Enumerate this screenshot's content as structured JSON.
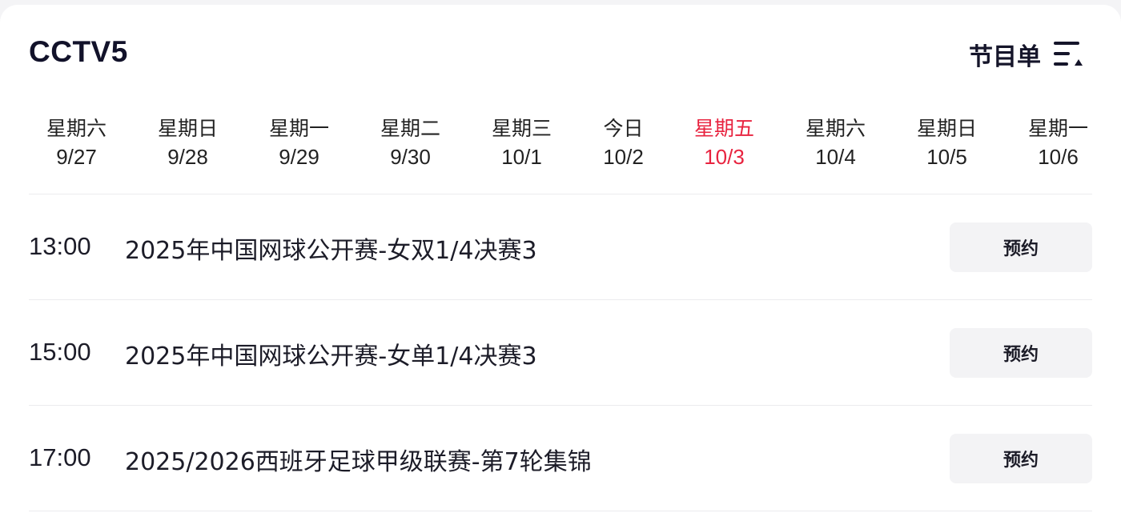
{
  "header": {
    "channel": "CCTV5",
    "guide_label": "节目单",
    "guide_icon": "list-sort-icon"
  },
  "days": [
    {
      "name": "星期六",
      "date": "9/27",
      "active": false
    },
    {
      "name": "星期日",
      "date": "9/28",
      "active": false
    },
    {
      "name": "星期一",
      "date": "9/29",
      "active": false
    },
    {
      "name": "星期二",
      "date": "9/30",
      "active": false
    },
    {
      "name": "星期三",
      "date": "10/1",
      "active": false
    },
    {
      "name": "今日",
      "date": "10/2",
      "active": false
    },
    {
      "name": "星期五",
      "date": "10/3",
      "active": true
    },
    {
      "name": "星期六",
      "date": "10/4",
      "active": false
    },
    {
      "name": "星期日",
      "date": "10/5",
      "active": false
    },
    {
      "name": "星期一",
      "date": "10/6",
      "active": false
    }
  ],
  "programs": [
    {
      "time": "13:00",
      "title": "2025年中国网球公开赛-女双1/4决赛3",
      "action": "预约"
    },
    {
      "time": "15:00",
      "title": "2025年中国网球公开赛-女单1/4决赛3",
      "action": "预约"
    },
    {
      "time": "17:00",
      "title": "2025/2026西班牙足球甲级联赛-第7轮集锦",
      "action": "预约"
    }
  ],
  "colors": {
    "accent": "#e8233f",
    "text": "#1c1c28",
    "button_bg": "#f3f3f5"
  }
}
